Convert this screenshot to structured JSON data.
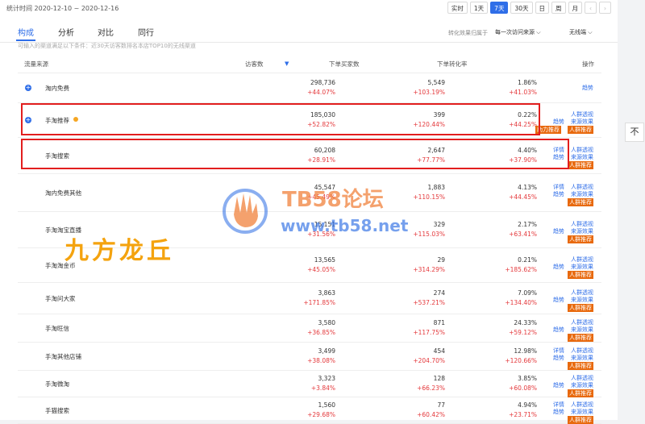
{
  "header": {
    "stat_period": "统计时间 2020-12-10 ~ 2020-12-16",
    "range_buttons": [
      "实时",
      "1天",
      "7天",
      "30天",
      "日",
      "周",
      "月"
    ],
    "active_range": "7天",
    "prev_arrow": "‹",
    "next_arrow": "›"
  },
  "tabs": [
    {
      "label": "构成",
      "active": true
    },
    {
      "label": "分析",
      "active": false
    },
    {
      "label": "对比",
      "active": false
    },
    {
      "label": "同行",
      "active": false
    }
  ],
  "filters": {
    "effect_label": "转化效果归属于",
    "effect_value": "每一次访问来源 ⌵",
    "scope_value": "无线端 ⌵"
  },
  "notice": "可输入的渠道满足以下条件：近30天访客数排名本店TOP10的无线渠道",
  "table": {
    "headers": {
      "source": "流量来源",
      "visitors": "访客数",
      "buyers": "下单买家数",
      "conversion": "下单转化率",
      "actions": "操作"
    },
    "rows": [
      {
        "source": "淘内免费",
        "expandable": true,
        "visitors": "298,736",
        "visitors_change": "+44.07%",
        "buyers": "5,549",
        "buyers_change": "+103.19%",
        "rate": "1.86%",
        "rate_change": "+41.03%",
        "ops": [
          "趋势"
        ]
      },
      {
        "source": "手淘推荐",
        "expandable": true,
        "visitors": "185,030",
        "visitors_change": "+52.82%",
        "buyers": "399",
        "buyers_change": "+120.44%",
        "rate": "0.22%",
        "rate_change": "+44.25%",
        "ops": [
          "人群透视",
          "趋势",
          "来源效果"
        ],
        "badges": [
          "助力推荐",
          "人群推荐"
        ]
      },
      {
        "source": "手淘搜索",
        "expandable": false,
        "visitors": "60,208",
        "visitors_change": "+28.91%",
        "buyers": "2,647",
        "buyers_change": "+77.77%",
        "rate": "4.40%",
        "rate_change": "+37.90%",
        "ops": [
          "详情",
          "人群透视",
          "趋势",
          "来源效果"
        ],
        "badges": [
          "人群推荐"
        ]
      },
      {
        "source": "淘内免费其他",
        "expandable": false,
        "visitors": "45,547",
        "visitors_change": "+45.49%",
        "buyers": "1,883",
        "buyers_change": "+110.15%",
        "rate": "4.13%",
        "rate_change": "+44.45%",
        "ops": [
          "详情",
          "人群透视",
          "趋势",
          "来源效果"
        ],
        "badges": [
          "人群推荐"
        ]
      },
      {
        "source": "手淘淘宝直播",
        "expandable": false,
        "visitors": "15,151",
        "visitors_change": "+31.56%",
        "buyers": "329",
        "buyers_change": "+115.03%",
        "rate": "2.17%",
        "rate_change": "+63.41%",
        "ops": [
          "人群透视",
          "趋势",
          "来源效果"
        ],
        "badges": [
          "人群推荐"
        ]
      },
      {
        "source": "手淘淘金币",
        "expandable": false,
        "visitors": "13,565",
        "visitors_change": "+45.05%",
        "buyers": "29",
        "buyers_change": "+314.29%",
        "rate": "0.21%",
        "rate_change": "+185.62%",
        "ops": [
          "人群透视",
          "趋势",
          "来源效果"
        ],
        "badges": [
          "人群推荐"
        ]
      },
      {
        "source": "手淘问大家",
        "expandable": false,
        "visitors": "3,863",
        "visitors_change": "+171.85%",
        "buyers": "274",
        "buyers_change": "+537.21%",
        "rate": "7.09%",
        "rate_change": "+134.40%",
        "ops": [
          "人群透视",
          "趋势",
          "来源效果"
        ],
        "badges": [
          "人群推荐"
        ]
      },
      {
        "source": "手淘旺信",
        "expandable": false,
        "visitors": "3,580",
        "visitors_change": "+36.85%",
        "buyers": "871",
        "buyers_change": "+117.75%",
        "rate": "24.33%",
        "rate_change": "+59.12%",
        "ops": [
          "人群透视",
          "趋势",
          "来源效果"
        ],
        "badges": [
          "人群推荐"
        ]
      },
      {
        "source": "手淘其他店铺",
        "expandable": false,
        "visitors": "3,499",
        "visitors_change": "+38.08%",
        "buyers": "454",
        "buyers_change": "+204.70%",
        "rate": "12.98%",
        "rate_change": "+120.66%",
        "ops": [
          "详情",
          "人群透视",
          "趋势",
          "来源效果"
        ],
        "badges": [
          "人群推荐"
        ]
      },
      {
        "source": "手淘微淘",
        "expandable": false,
        "visitors": "3,323",
        "visitors_change": "+3.84%",
        "buyers": "128",
        "buyers_change": "+66.23%",
        "rate": "3.85%",
        "rate_change": "+60.08%",
        "ops": [
          "人群透视",
          "趋势",
          "来源效果"
        ],
        "badges": [
          "人群推荐"
        ]
      },
      {
        "source": "手猫搜索",
        "expandable": false,
        "visitors": "1,560",
        "visitors_change": "+29.68%",
        "buyers": "77",
        "buyers_change": "+60.42%",
        "rate": "4.94%",
        "rate_change": "+23.71%",
        "ops": [
          "详情",
          "人群透视",
          "趋势",
          "来源效果"
        ],
        "badges": [
          "人群推荐"
        ]
      }
    ]
  },
  "watermarks": {
    "brand": "TB58论坛",
    "url": "www.tb58.net",
    "overlay": "九方龙丘"
  },
  "side_button": "不",
  "colors": {
    "accent": "#2f6ee8",
    "increase": "#e4393c",
    "badge": "#e8690d",
    "highlight": "#e21e1e"
  }
}
